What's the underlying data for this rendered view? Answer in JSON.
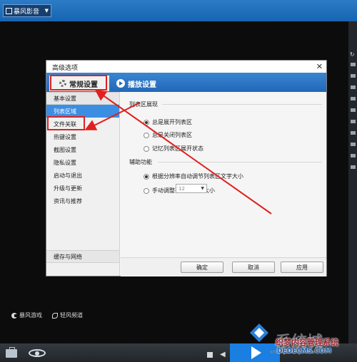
{
  "app": {
    "logo_text": "暴风影音",
    "bottom_links": [
      {
        "icon": "game-icon",
        "label": "暴风游戏"
      },
      {
        "icon": "feather-icon",
        "label": "轻风频道"
      }
    ]
  },
  "dialog": {
    "title": "高级选项",
    "tabs": [
      {
        "label": "常规设置",
        "icon": "gear-icon",
        "active": true
      },
      {
        "label": "播放设置",
        "icon": "play-settings-icon",
        "active": false
      }
    ],
    "sidebar": {
      "header": "基本设置",
      "items": [
        "列表区域",
        "文件关联",
        "热键设置",
        "截图设置",
        "隐私设置",
        "启动与退出",
        "升级与更新",
        "资讯与推荐"
      ],
      "footer": "缓存与网络",
      "selected": "列表区域"
    },
    "section_list": {
      "title": "列表区展现",
      "options": [
        {
          "label": "总是展开列表区",
          "checked": true
        },
        {
          "label": "总是关闭列表区",
          "checked": false
        },
        {
          "label": "记忆列表区展开状态",
          "checked": false
        }
      ]
    },
    "section_aux": {
      "title": "辅助功能",
      "options": [
        {
          "label": "根据分辨率自动调节列表区文字大小",
          "checked": true
        },
        {
          "label": "手动调整列表区文字大小",
          "checked": false
        }
      ],
      "font_size_value": "12"
    },
    "buttons": {
      "ok": "确定",
      "cancel": "取消",
      "apply": "应用"
    }
  },
  "watermark": {
    "title": "织梦内容管理系统",
    "url": "DEDECMS.COM",
    "site": "xitongcheng.com",
    "ghost": "系统城"
  },
  "colors": {
    "accent": "#2168b8",
    "selected": "#3c8ee3",
    "highlight": "#e02020"
  }
}
